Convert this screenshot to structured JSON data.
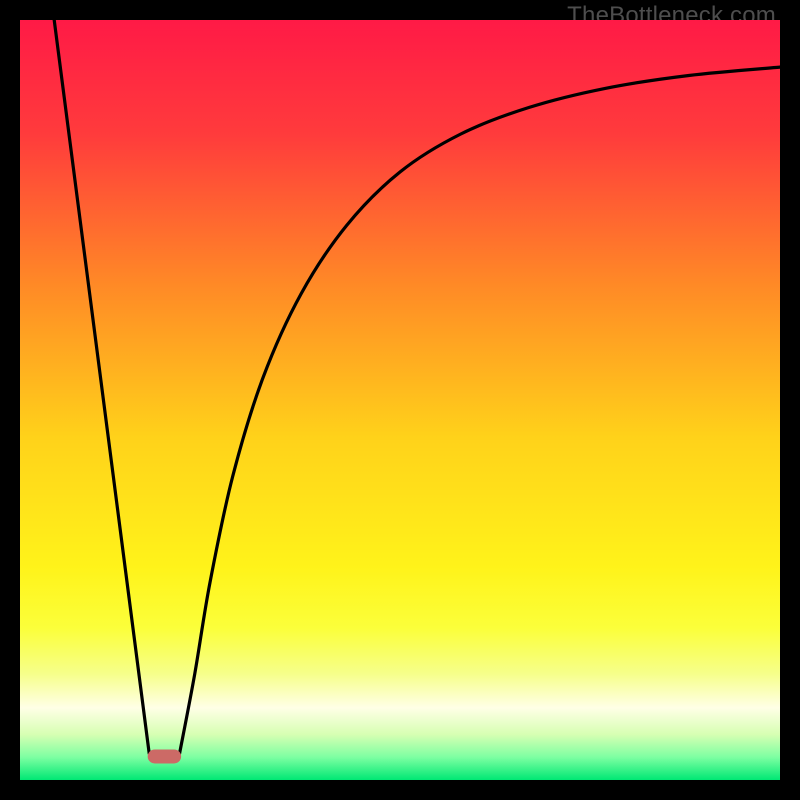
{
  "watermark": "TheBottleneck.com",
  "chart_data": {
    "type": "line",
    "title": "",
    "xlabel": "",
    "ylabel": "",
    "xlim": [
      0,
      100
    ],
    "ylim": [
      0,
      100
    ],
    "background_gradient_stops": [
      {
        "offset": 0.0,
        "color": "#ff1a46"
      },
      {
        "offset": 0.15,
        "color": "#ff3b3c"
      },
      {
        "offset": 0.35,
        "color": "#ff8a26"
      },
      {
        "offset": 0.55,
        "color": "#ffd21a"
      },
      {
        "offset": 0.72,
        "color": "#fff31a"
      },
      {
        "offset": 0.8,
        "color": "#fbff3a"
      },
      {
        "offset": 0.86,
        "color": "#f6ff8a"
      },
      {
        "offset": 0.905,
        "color": "#ffffe6"
      },
      {
        "offset": 0.94,
        "color": "#d7ffb3"
      },
      {
        "offset": 0.97,
        "color": "#7dffa2"
      },
      {
        "offset": 1.0,
        "color": "#00e874"
      }
    ],
    "series": [
      {
        "name": "left-descent",
        "x": [
          4.5,
          17.0
        ],
        "y": [
          100,
          3.5
        ]
      },
      {
        "name": "right-curve",
        "x": [
          21.0,
          23,
          25,
          28,
          32,
          37,
          43,
          50,
          58,
          67,
          77,
          88,
          100
        ],
        "y": [
          3.5,
          14,
          26,
          40,
          53,
          64,
          73,
          80,
          85,
          88.5,
          91,
          92.7,
          93.8
        ]
      }
    ],
    "marker": {
      "name": "bottleneck-marker",
      "x_center": 19.0,
      "x_halfwidth": 2.2,
      "y": 3.1,
      "color": "#cc6a66"
    },
    "frame": {
      "outer_size_px": 800,
      "border_px": 20,
      "border_color": "#000000"
    }
  }
}
